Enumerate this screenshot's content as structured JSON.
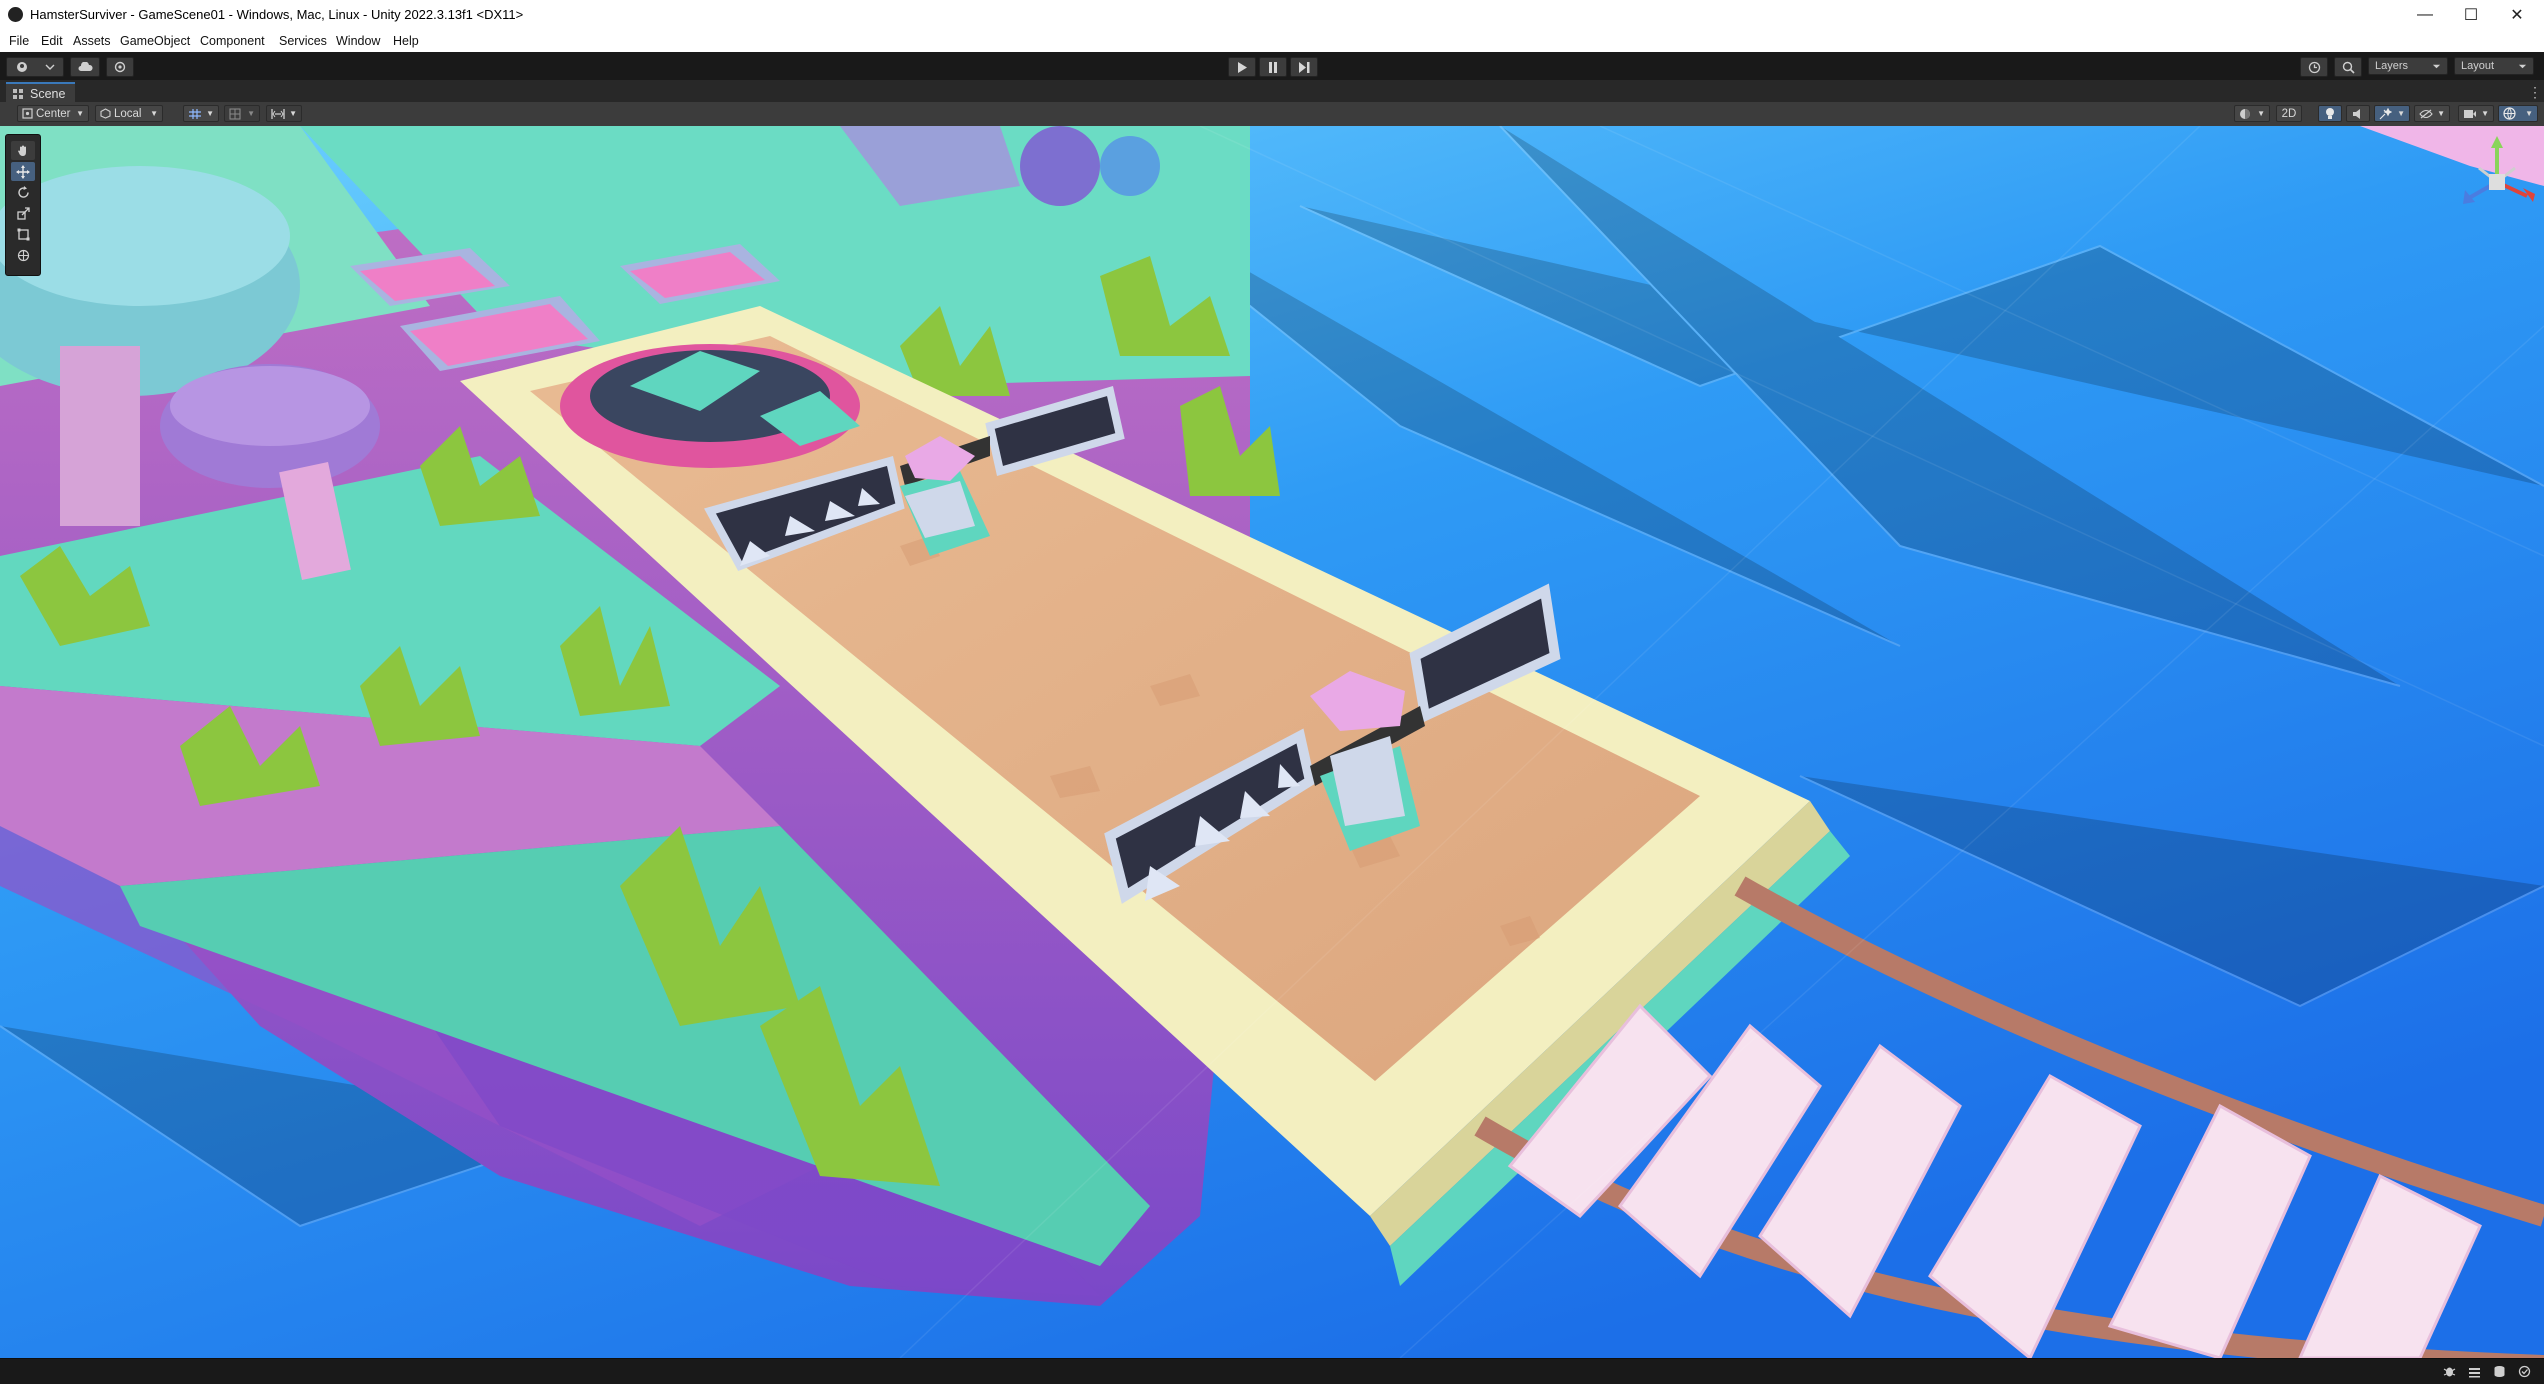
{
  "window": {
    "title": "HamsterSurviver - GameScene01 - Windows, Mac, Linux - Unity 2022.3.13f1 <DX11>",
    "minimize_glyph": "—",
    "maximize_glyph": "☐",
    "close_glyph": "✕"
  },
  "menu": [
    "File",
    "Edit",
    "Assets",
    "GameObject",
    "Component",
    "Services",
    "Window",
    "Help"
  ],
  "toolbar": {
    "play_icon": "play-icon",
    "pause_icon": "pause-icon",
    "step_icon": "step-icon",
    "layers_label": "Layers",
    "layout_label": "Layout"
  },
  "scene_tab": {
    "label": "Scene"
  },
  "scene_toolbar": {
    "pivot_label": "Center",
    "space_label": "Local",
    "mode_2d_label": "2D"
  },
  "colors": {
    "editor_dark": "#191919",
    "panel": "#3c3c3c",
    "accent_blue": "#3a79bb",
    "water": "#2f8ef0",
    "sand": "#e2b08a",
    "border_cream": "#f3efc0",
    "teal": "#5fd6bf",
    "pink": "#e7a5d6",
    "grass": "#8cc63f"
  }
}
